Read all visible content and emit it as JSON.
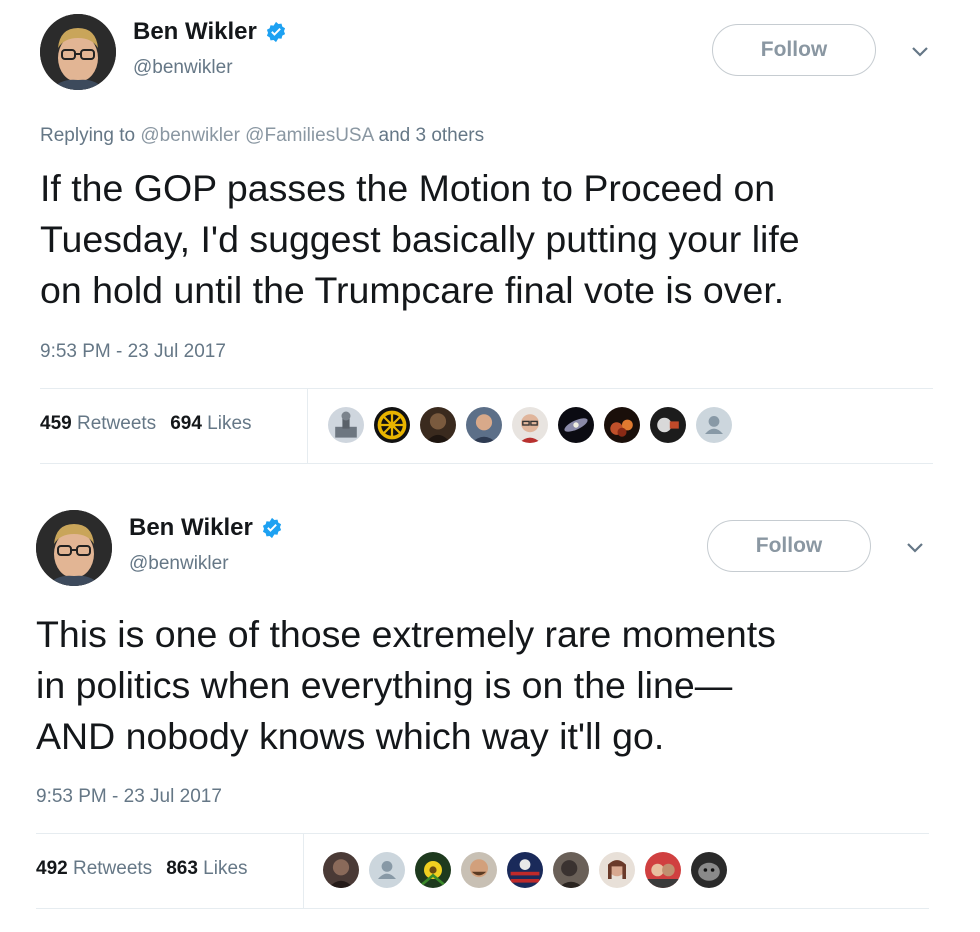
{
  "tweets": [
    {
      "author_name": "Ben Wikler",
      "author_handle": "@benwikler",
      "follow_label": "Follow",
      "reply_prefix": "Replying to",
      "reply_mention_1": "@benwikler",
      "reply_mention_2": "@FamiliesUSA",
      "reply_suffix": "and 3 others",
      "text_lines": [
        "If the GOP passes the Motion to Proceed on",
        "Tuesday, I'd suggest basically putting your life",
        "on hold until the Trumpcare final vote is over."
      ],
      "timestamp": "9:53 PM - 23 Jul 2017",
      "retweets_count": "459",
      "retweets_label": "Retweets",
      "likes_count": "694",
      "likes_label": "Likes",
      "likers": [
        "landmark-photo-avatar",
        "wheel-emblem-avatar",
        "dark-photo-avatar",
        "man-photo-avatar",
        "glasses-man-avatar",
        "galaxy-avatar",
        "fire-avatar",
        "logo-avatar",
        "default-avatar"
      ]
    },
    {
      "author_name": "Ben Wikler",
      "author_handle": "@benwikler",
      "follow_label": "Follow",
      "text_lines": [
        "This is one of those extremely rare moments",
        "in politics when everything is on the line—",
        "AND nobody knows which way it'll go."
      ],
      "timestamp": "9:53 PM - 23 Jul 2017",
      "retweets_count": "492",
      "retweets_label": "Retweets",
      "likes_count": "863",
      "likes_label": "Likes",
      "likers": [
        "dark-photo-avatar",
        "default-avatar",
        "flower-avatar",
        "man-photo-avatar",
        "flag-avatar",
        "person-photo-avatar",
        "woman-photo-avatar",
        "group-photo-avatar",
        "animal-photo-avatar"
      ]
    }
  ],
  "colors": {
    "verified": "#1da1f2",
    "secondary_text": "#657786",
    "primary_text": "#14171a",
    "divider": "#e6ecf0"
  },
  "icons": {
    "verified": "verified-badge-icon",
    "chevron": "chevron-down-icon"
  }
}
